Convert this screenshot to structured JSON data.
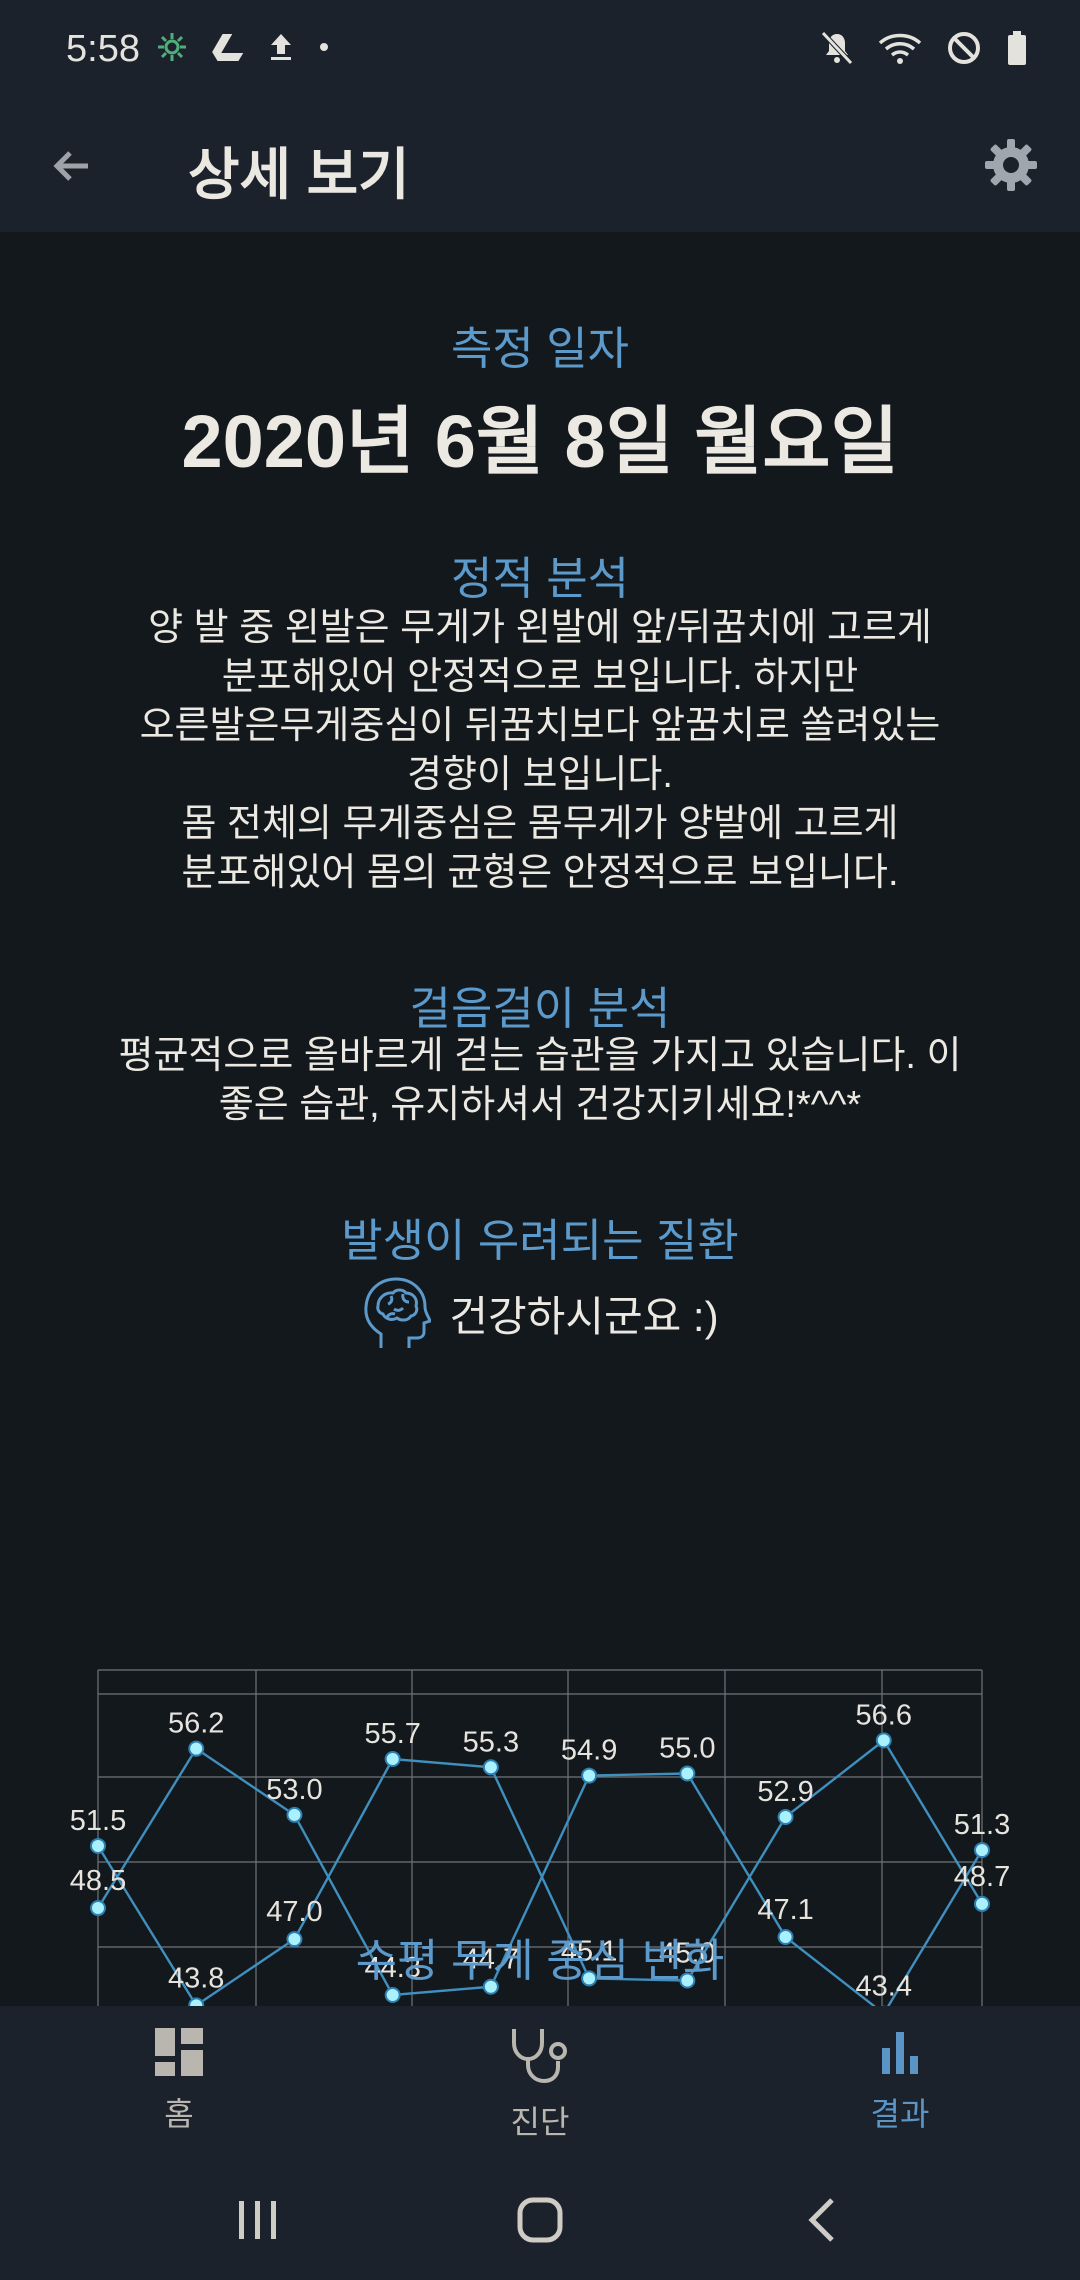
{
  "status_bar": {
    "time": "5:58",
    "left_icons": [
      "pinwheel-icon",
      "drive-icon",
      "upload-icon",
      "dot-icon"
    ],
    "right_icons": [
      "mute-icon",
      "wifi-icon",
      "do-not-disturb-icon",
      "battery-icon"
    ]
  },
  "app_bar": {
    "title": "상세 보기",
    "back_icon": "arrow-back-icon",
    "settings_icon": "gear-icon"
  },
  "measurement": {
    "label": "측정 일자",
    "date": "2020년 6월 8일 월요일"
  },
  "static_analysis": {
    "title": "정적 분석",
    "lines": [
      "양 발 중 왼발은 무게가 왼발에 앞/뒤꿈치에 고르게",
      "분포해있어 안정적으로 보입니다. 하지만",
      "오른발은무게중심이 뒤꿈치보다 앞꿈치로 쏠려있는",
      "경향이 보입니다.",
      "몸 전체의 무게중심은 몸무게가 양발에 고르게",
      "분포해있어 몸의 균형은 안정적으로 보입니다."
    ]
  },
  "gait_analysis": {
    "title": "걸음걸이 분석",
    "lines": [
      "평균적으로 올바르게 걷는 습관을 가지고 있습니다. 이",
      "좋은 습관, 유지하셔서 건강지키세요!*^^*"
    ]
  },
  "disease": {
    "title": "발생이 우려되는 질환",
    "icon": "brain-head-icon",
    "text": "건강하시군요 :)"
  },
  "chart_data": {
    "type": "line",
    "title": "",
    "xlabel": "",
    "ylabel": "",
    "x": [
      1,
      2,
      3,
      4,
      5,
      6,
      7,
      8,
      9,
      10
    ],
    "series": [
      {
        "values": [
          51.5,
          43.8,
          47.0,
          55.7,
          55.3,
          45.1,
          45.0,
          52.9,
          56.6,
          48.7
        ]
      },
      {
        "values": [
          48.5,
          56.2,
          53.0,
          44.3,
          44.7,
          54.9,
          55.0,
          47.1,
          43.4,
          51.3
        ]
      }
    ],
    "ylim": [
      40,
      60
    ],
    "grid": true,
    "line_color": "#3f8fbf",
    "marker_color": "#a9f1ff",
    "value_labels": true
  },
  "next_section": {
    "title": "수평 무게 중심 변화"
  },
  "bottom_nav": {
    "items": [
      {
        "label": "홈",
        "icon": "dashboard-icon",
        "active": false
      },
      {
        "label": "진단",
        "icon": "stethoscope-icon",
        "active": false
      },
      {
        "label": "결과",
        "icon": "bar-chart-icon",
        "active": true
      }
    ],
    "active_color": "#5a95c6",
    "inactive_color": "#b9b6b0"
  },
  "system_nav": {
    "buttons": [
      "recent-apps-icon",
      "home-icon",
      "back-chevron-icon"
    ]
  }
}
